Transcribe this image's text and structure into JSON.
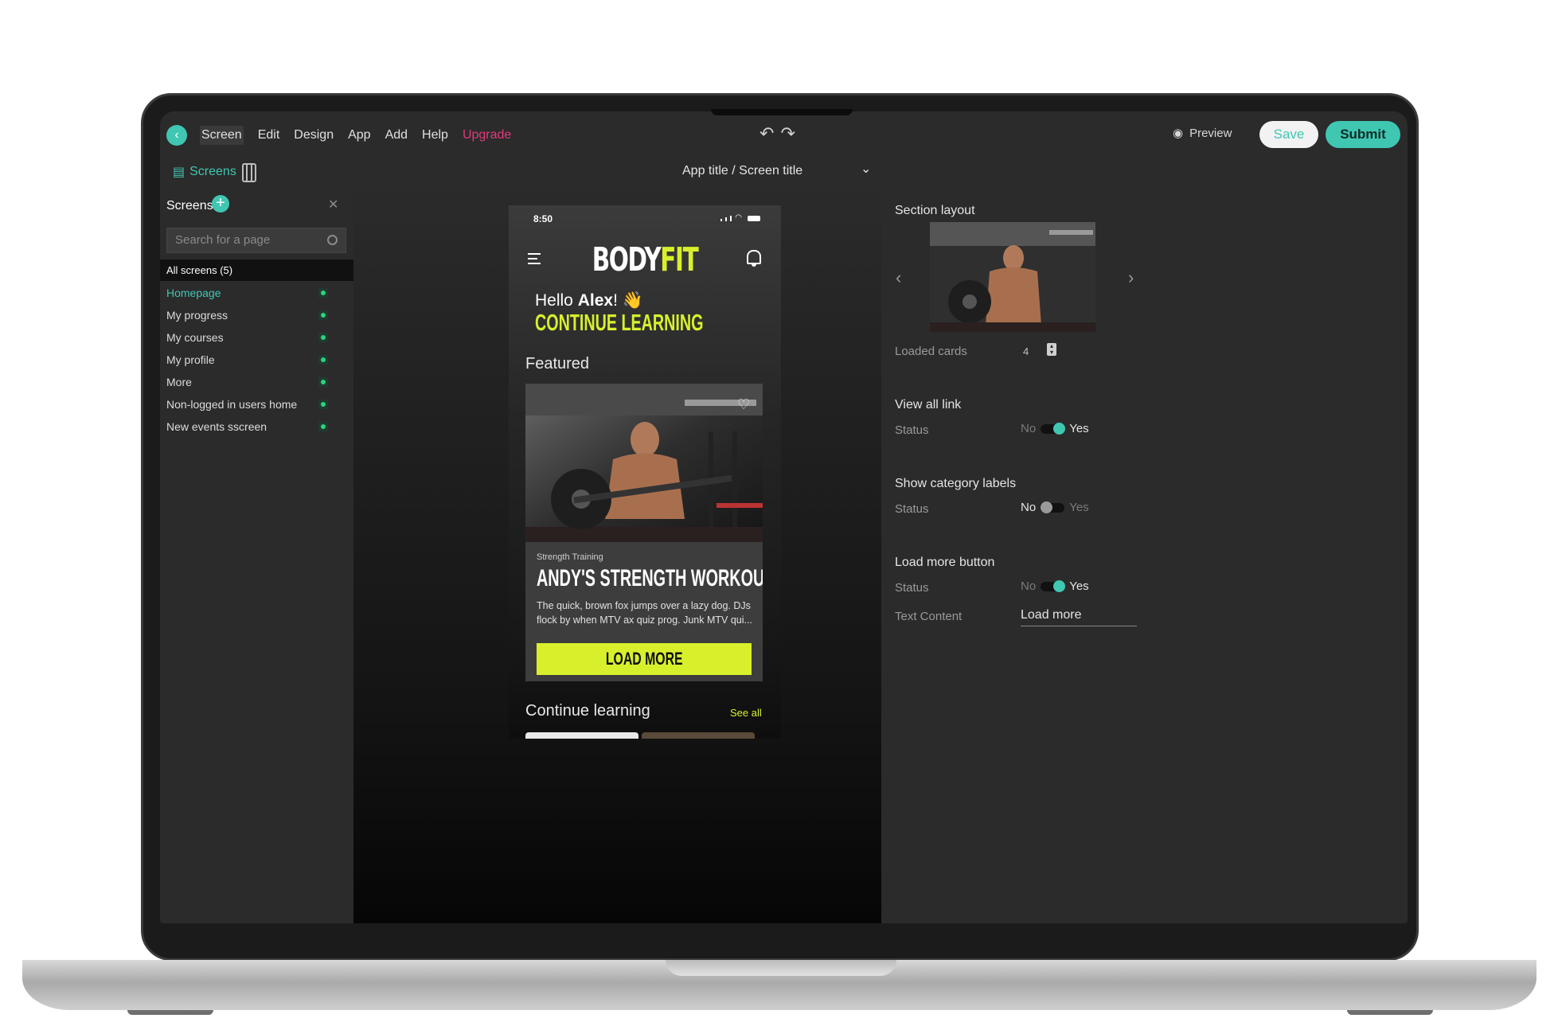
{
  "menubar": {
    "menu_items": [
      "Screen",
      "Edit",
      "Design",
      "App",
      "Add",
      "Help",
      "Upgrade"
    ],
    "preview_label": "Preview",
    "save_label": "Save",
    "submit_label": "Submit"
  },
  "toolbar": {
    "screens_tab": "Screens",
    "screen_selector": "App title / Screen title"
  },
  "sidebar": {
    "title": "Screens",
    "search_placeholder": "Search for a page",
    "all_screens": "All screens (5)",
    "items": [
      {
        "label": "Homepage",
        "active": true
      },
      {
        "label": "My progress"
      },
      {
        "label": "My courses"
      },
      {
        "label": "My profile"
      },
      {
        "label": "More"
      },
      {
        "label": "Non-logged in users home"
      },
      {
        "label": "New events sscreen"
      }
    ]
  },
  "phone": {
    "time": "8:50",
    "logo_a": "BODY",
    "logo_b": "FIT",
    "hello_prefix": "Hello ",
    "hello_name": "Alex",
    "hello_suffix": "! 👋",
    "continue_heading": "CONTINUE LEARNING",
    "featured_label": "Featured",
    "card": {
      "category": "Strength Training",
      "title": "ANDY'S STRENGTH WORKOUT",
      "description": "The quick, brown fox jumps over a lazy dog. DJs flock by when MTV ax quiz prog. Junk MTV qui...",
      "button": "LOAD MORE"
    },
    "continue_label": "Continue learning",
    "see_all": "See all"
  },
  "rpanel": {
    "section_layout": "Section layout",
    "loaded_cards_label": "Loaded cards",
    "loaded_cards_value": "4",
    "view_all_link": "View all link",
    "show_category_labels": "Show category labels",
    "load_more_button": "Load more button",
    "status_label": "Status",
    "no_label": "No",
    "yes_label": "Yes",
    "text_content_label": "Text Content",
    "text_content_value": "Load more"
  },
  "colors": {
    "accent": "#3fc7b2",
    "brand_lime": "#d8f02c",
    "upgrade": "#e23a7a"
  }
}
